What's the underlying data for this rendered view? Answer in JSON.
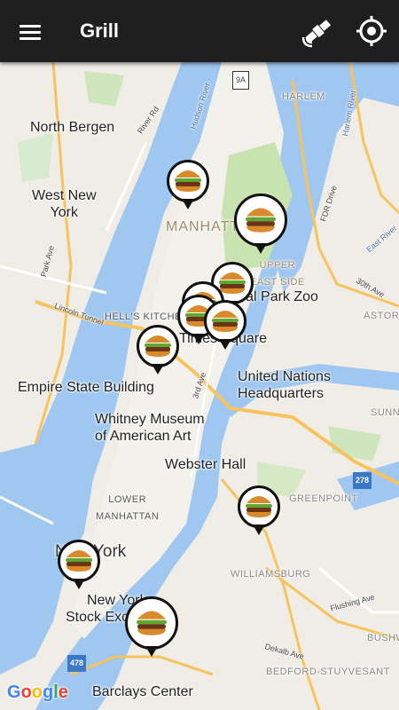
{
  "app_bar": {
    "title": "Grill"
  },
  "icons": {
    "menu": "hamburger-menu-icon",
    "satellite": "satellite-icon",
    "my_location": "crosshair-location-icon",
    "burger": "hamburger-food-icon"
  },
  "map": {
    "labels": {
      "north_bergen": "North Bergen",
      "west_new_york": "West New\nYork",
      "manhattan": "MANHATTAN",
      "upper_east_side": "UPPER\nEAST SIDE",
      "central_park_zoo": "Central Park Zoo",
      "hells_kitchen": "HELL'S KITCHEN",
      "times_square": "Times Square",
      "empire_state": "Empire State Building",
      "united_nations": "United Nations\nHeadquarters",
      "whitney": "Whitney Museum\nof American Art",
      "webster_hall": "Webster Hall",
      "lower_manhattan": "LOWER\nMANHATTAN",
      "greenpoint": "GREENPOINT",
      "new_york": "New York",
      "nyse": "New York\nStock Exchange",
      "williamsburg": "WILLIAMSBURG",
      "bedford": "BEDFORD-STUYVESANT",
      "barclays": "Barclays Center",
      "harlem": "HARLEM",
      "astoria": "ASTORIA",
      "sunnyside": "SUNNY",
      "bushwick": "BUSHW",
      "hudson_river": "Hudson River",
      "harlem_river": "Harlem River",
      "east_river": "East River",
      "lincoln_tunnel": "Lincoln Tunnel",
      "river_rd": "River Rd",
      "park_ave": "Park Ave",
      "fdr_drive": "FDR Drive",
      "third_ave": "3rd Ave",
      "flushing_ave": "Flushing Ave",
      "dekalb_ave": "Dekalb Ave",
      "thirtieth_ave": "30th Ave",
      "hwy_278": "278",
      "hwy_478": "478",
      "hwy_9a": "9A",
      "google": "Google"
    }
  }
}
